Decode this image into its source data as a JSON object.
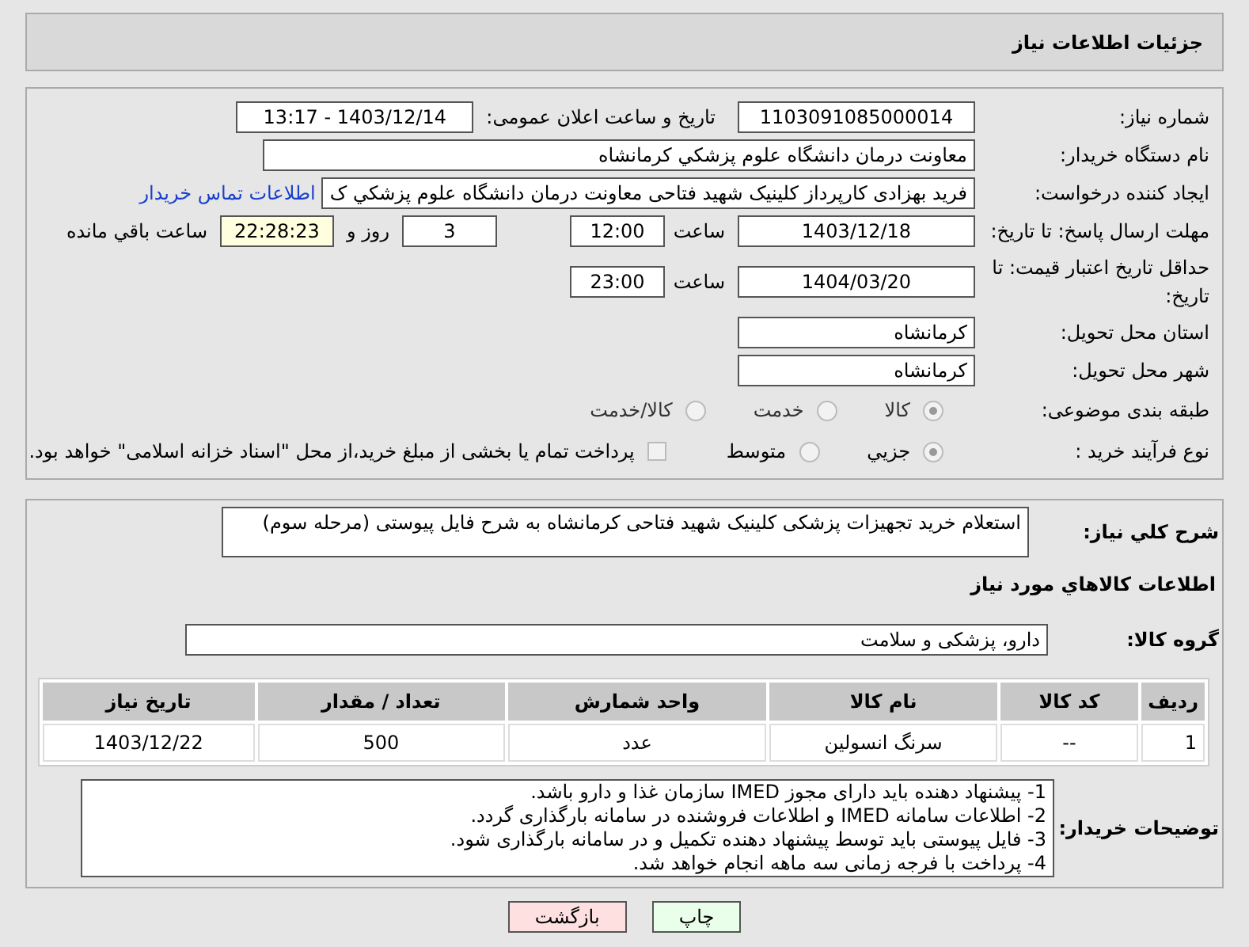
{
  "header": {
    "title": "جزئیات اطلاعات نیاز"
  },
  "need_number": {
    "label": "شماره نیاز:",
    "value": "1103091085000014"
  },
  "announce": {
    "label": "تاریخ و ساعت اعلان عمومی:",
    "value": "1403/12/14 - 13:17"
  },
  "buyer_org": {
    "label": "نام دستگاه خریدار:",
    "value": "معاونت درمان دانشگاه علوم پزشکي کرمانشاه"
  },
  "creator": {
    "label": "ایجاد کننده درخواست:",
    "value": "فرید بهزادی کارپرداز کلینیک شهید فتاحی معاونت درمان دانشگاه علوم پزشکي ک",
    "link": "اطلاعات تماس خریدار"
  },
  "deadline": {
    "label": "مهلت ارسال پاسخ: تا تاریخ:",
    "date": "1403/12/18",
    "time_label": "ساعت",
    "time": "12:00",
    "days": "3",
    "days_label": "روز و",
    "remaining": "22:28:23",
    "remaining_label": "ساعت باقي مانده"
  },
  "validity": {
    "label": "حداقل تاریخ اعتبار قیمت: تا تاریخ:",
    "date": "1404/03/20",
    "time_label": "ساعت",
    "time": "23:00"
  },
  "province": {
    "label": "استان محل تحویل:",
    "value": "کرمانشاه"
  },
  "city": {
    "label": "شهر محل تحویل:",
    "value": "کرمانشاه"
  },
  "category": {
    "label": "طبقه بندی موضوعی:",
    "options": [
      {
        "label": "کالا",
        "selected": true
      },
      {
        "label": "خدمت",
        "selected": false
      },
      {
        "label": "کالا/خدمت",
        "selected": false
      }
    ]
  },
  "process": {
    "label": "نوع فرآیند خرید :",
    "options": [
      {
        "label": "جزیي",
        "selected": true
      },
      {
        "label": "متوسط",
        "selected": false
      }
    ],
    "checkbox": {
      "label": "پرداخت تمام یا بخشی از مبلغ خرید،از محل \"اسناد خزانه اسلامی\" خواهد بود.",
      "checked": false
    }
  },
  "description": {
    "label": "شرح کلي نیاز:",
    "value": "استعلام خرید تجهیزات پزشکی کلینیک شهید فتاحی کرمانشاه به شرح فایل پیوستی (مرحله سوم)"
  },
  "goods_title": "اطلاعات کالاهاي مورد نیاز",
  "group": {
    "label": "گروه کالا:",
    "value": "دارو، پزشکی و سلامت"
  },
  "table": {
    "columns": [
      "ردیف",
      "کد کالا",
      "نام کالا",
      "واحد شمارش",
      "تعداد / مقدار",
      "تاریخ نیاز"
    ],
    "rows": [
      [
        "1",
        "--",
        "سرنگ انسولین",
        "عدد",
        "500",
        "1403/12/22"
      ]
    ]
  },
  "buyer_notes": {
    "label": "توضیحات خریدار:",
    "lines": [
      "1- پیشنهاد دهنده باید دارای مجوز IMED سازمان غذا و دارو باشد.",
      "2- اطلاعات سامانه IMED و اطلاعات فروشنده در سامانه بارگذاری گردد.",
      "3- فایل پیوستی باید توسط پیشنهاد دهنده تکمیل و در سامانه بارگذاری شود.",
      "4- پرداخت با فرجه زمانی سه ماهه انجام خواهد شد."
    ]
  },
  "buttons": [
    {
      "label": "چاپ",
      "kind": "print"
    },
    {
      "label": "بازگشت",
      "kind": "back"
    }
  ]
}
